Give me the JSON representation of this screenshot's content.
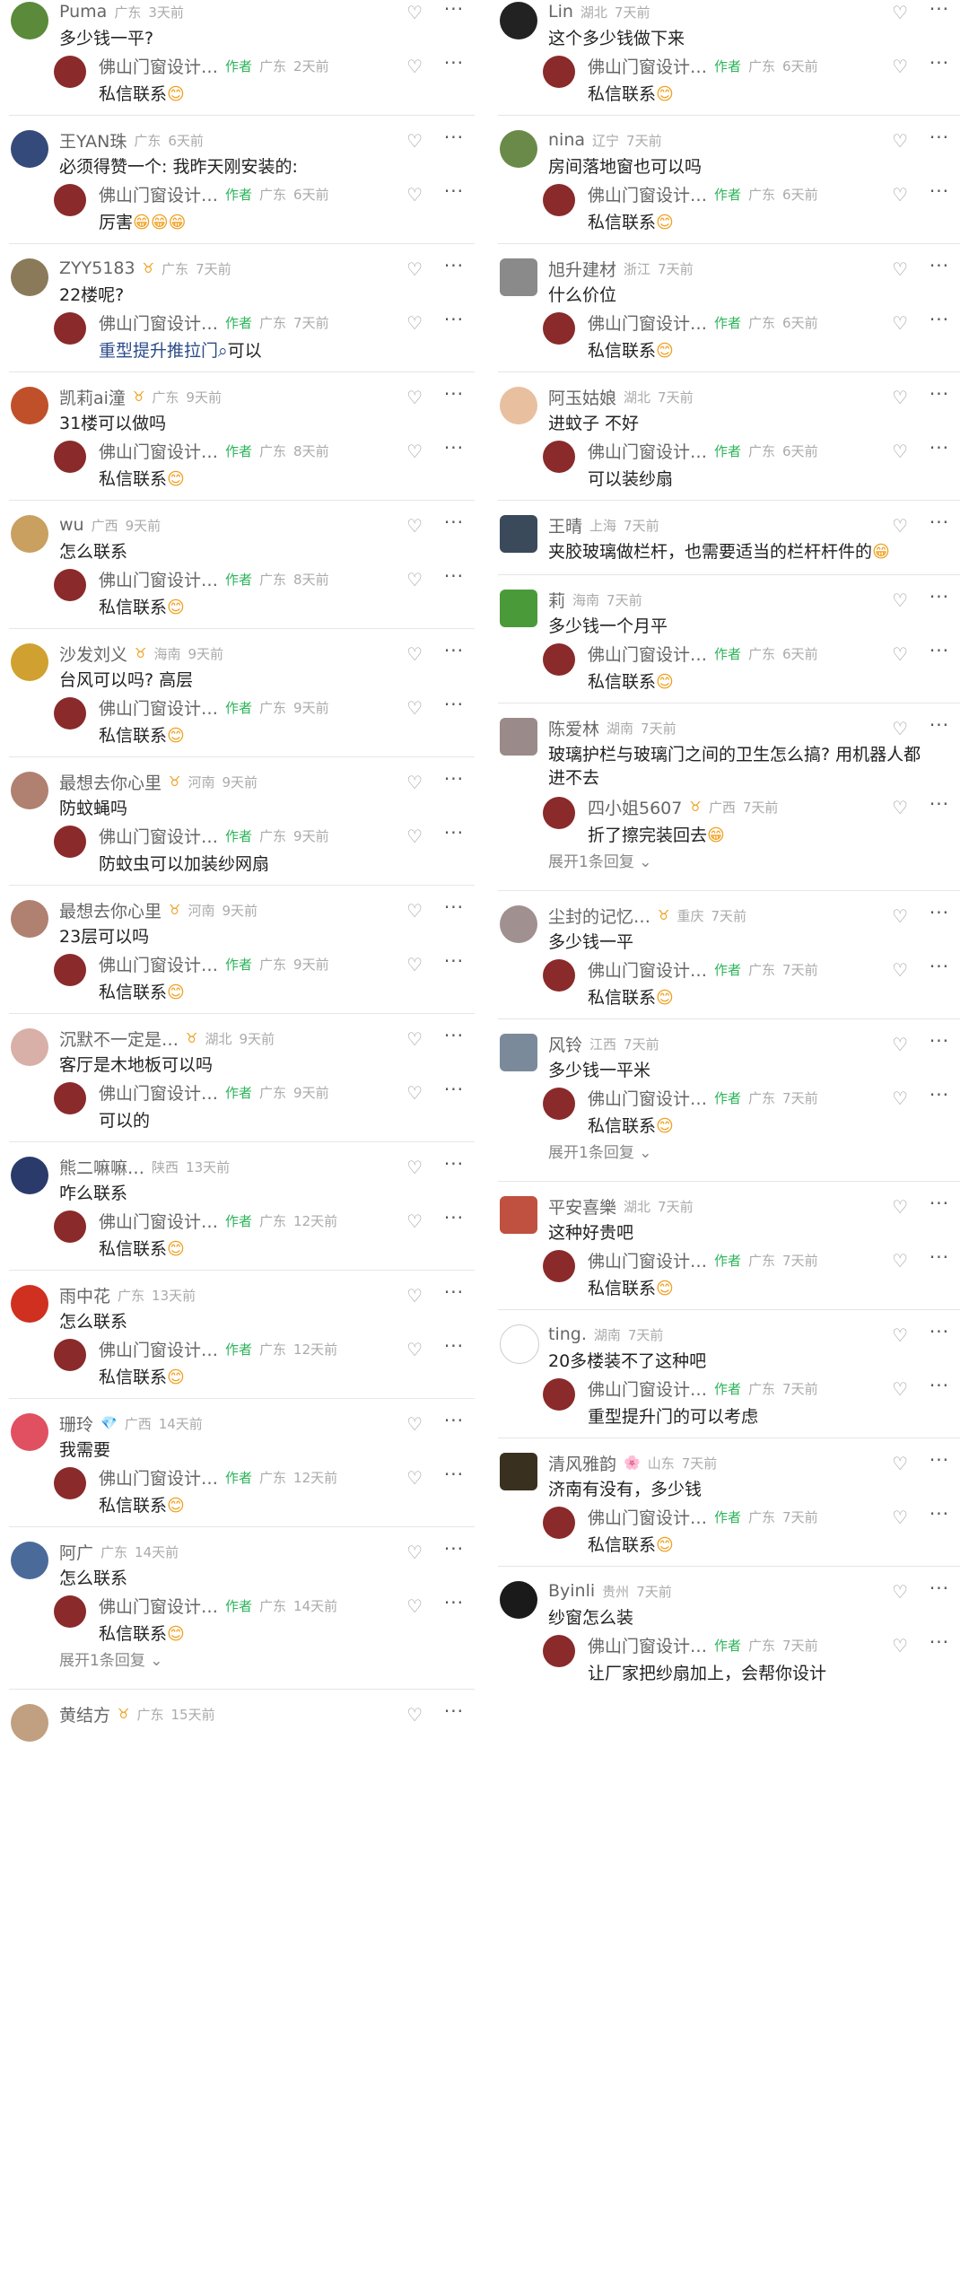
{
  "left": [
    {
      "name": "Puma",
      "loc": "广东",
      "time": "3天前",
      "text": "多少钱一平?",
      "avatar": "#5a8a3a",
      "replies": [
        {
          "name": "佛山门窗设计…",
          "author": "作者",
          "loc": "广东",
          "time": "2天前",
          "text": "私信联系",
          "emoji": "😊"
        }
      ]
    },
    {
      "name": "王YAN珠",
      "loc": "广东",
      "time": "6天前",
      "text": "必须得赞一个: 我昨天刚安装的:",
      "avatar": "#344a7a",
      "replies": [
        {
          "name": "佛山门窗设计…",
          "author": "作者",
          "loc": "广东",
          "time": "6天前",
          "text": "厉害",
          "emoji": "😁😁😁"
        }
      ]
    },
    {
      "name": "ZYY5183",
      "badge": "♉",
      "loc": "广东",
      "time": "7天前",
      "text": "22楼呢?",
      "avatar": "#8a7a5a",
      "replies": [
        {
          "name": "佛山门窗设计…",
          "author": "作者",
          "loc": "广东",
          "time": "7天前",
          "text": "重型提升推拉门",
          "link": true,
          "text2": "可以"
        }
      ]
    },
    {
      "name": "凯莉ai潼",
      "badge": "♉",
      "loc": "广东",
      "time": "9天前",
      "text": "31楼可以做吗",
      "avatar": "#c0502a",
      "replies": [
        {
          "name": "佛山门窗设计…",
          "author": "作者",
          "loc": "广东",
          "time": "8天前",
          "text": "私信联系",
          "emoji": "😊"
        }
      ]
    },
    {
      "name": "wu",
      "loc": "广西",
      "time": "9天前",
      "text": "怎么联系",
      "avatar": "#c9a060",
      "replies": [
        {
          "name": "佛山门窗设计…",
          "author": "作者",
          "loc": "广东",
          "time": "8天前",
          "text": "私信联系",
          "emoji": "😊"
        }
      ]
    },
    {
      "name": "沙发刘义",
      "badge": "♉",
      "loc": "海南",
      "time": "9天前",
      "text": "台风可以吗? 高层",
      "avatar": "#d0a030",
      "replies": [
        {
          "name": "佛山门窗设计…",
          "author": "作者",
          "loc": "广东",
          "time": "9天前",
          "text": "私信联系",
          "emoji": "😊"
        }
      ]
    },
    {
      "name": "最想去你心里",
      "badge": "♉",
      "loc": "河南",
      "time": "9天前",
      "text": "防蚊蝇吗",
      "avatar": "#b08070",
      "replies": [
        {
          "name": "佛山门窗设计…",
          "author": "作者",
          "loc": "广东",
          "time": "9天前",
          "text": "防蚊虫可以加装纱网扇"
        }
      ]
    },
    {
      "name": "最想去你心里",
      "badge": "♉",
      "loc": "河南",
      "time": "9天前",
      "text": "23层可以吗",
      "avatar": "#b08070",
      "replies": [
        {
          "name": "佛山门窗设计…",
          "author": "作者",
          "loc": "广东",
          "time": "9天前",
          "text": "私信联系",
          "emoji": "😊"
        }
      ]
    },
    {
      "name": "沉默不一定是…",
      "badge": "♉",
      "loc": "湖北",
      "time": "9天前",
      "text": "客厅是木地板可以吗",
      "avatar": "#d8b0a8",
      "replies": [
        {
          "name": "佛山门窗设计…",
          "author": "作者",
          "loc": "广东",
          "time": "9天前",
          "text": "可以的"
        }
      ]
    },
    {
      "name": "熊二嘛嘛…",
      "loc": "陕西",
      "time": "13天前",
      "text": "咋么联系",
      "avatar": "#2a3a6a",
      "replies": [
        {
          "name": "佛山门窗设计…",
          "author": "作者",
          "loc": "广东",
          "time": "12天前",
          "text": "私信联系",
          "emoji": "😊"
        }
      ]
    },
    {
      "name": "雨中花",
      "loc": "广东",
      "time": "13天前",
      "text": "怎么联系",
      "avatar": "#d03020",
      "replies": [
        {
          "name": "佛山门窗设计…",
          "author": "作者",
          "loc": "广东",
          "time": "12天前",
          "text": "私信联系",
          "emoji": "😊"
        }
      ]
    },
    {
      "name": "珊玲",
      "badge": "💎",
      "loc": "广西",
      "time": "14天前",
      "text": "我需要",
      "avatar": "#e05060",
      "replies": [
        {
          "name": "佛山门窗设计…",
          "author": "作者",
          "loc": "广东",
          "time": "12天前",
          "text": "私信联系",
          "emoji": "😊"
        }
      ]
    },
    {
      "name": "阿广",
      "loc": "广东",
      "time": "14天前",
      "text": "怎么联系",
      "avatar": "#4a6a9a",
      "replies": [
        {
          "name": "佛山门窗设计…",
          "author": "作者",
          "loc": "广东",
          "time": "14天前",
          "text": "私信联系",
          "emoji": "😊"
        }
      ],
      "expand": "展开1条回复"
    },
    {
      "name": "黄结方",
      "badge": "♉",
      "loc": "广东",
      "time": "15天前",
      "text": "",
      "avatar": "#c0a080",
      "replies": []
    }
  ],
  "right": [
    {
      "name": "Lin",
      "loc": "湖北",
      "time": "7天前",
      "text": "这个多少钱做下来",
      "avatar": "#222222",
      "replies": [
        {
          "name": "佛山门窗设计…",
          "author": "作者",
          "loc": "广东",
          "time": "6天前",
          "text": "私信联系",
          "emoji": "😊"
        }
      ]
    },
    {
      "name": "nina",
      "loc": "辽宁",
      "time": "7天前",
      "text": "房间落地窗也可以吗",
      "avatar": "#6a8a4a",
      "replies": [
        {
          "name": "佛山门窗设计…",
          "author": "作者",
          "loc": "广东",
          "time": "6天前",
          "text": "私信联系",
          "emoji": "😊"
        }
      ]
    },
    {
      "name": "旭升建材",
      "loc": "浙江",
      "time": "7天前",
      "text": "什么价位",
      "avatar": "#8a8a8a",
      "square": true,
      "replies": [
        {
          "name": "佛山门窗设计…",
          "author": "作者",
          "loc": "广东",
          "time": "6天前",
          "text": "私信联系",
          "emoji": "😊"
        }
      ]
    },
    {
      "name": "阿玉姑娘",
      "loc": "湖北",
      "time": "7天前",
      "text": "进蚊子 不好",
      "avatar": "#e8c0a0",
      "replies": [
        {
          "name": "佛山门窗设计…",
          "author": "作者",
          "loc": "广东",
          "time": "6天前",
          "text": "可以装纱扇"
        }
      ]
    },
    {
      "name": "王晴",
      "loc": "上海",
      "time": "7天前",
      "text": "夹胶玻璃做栏杆，也需要适当的栏杆杆件的",
      "emoji": "😁",
      "avatar": "#3a4a5a",
      "square": true,
      "replies": []
    },
    {
      "name": "莉",
      "loc": "海南",
      "time": "7天前",
      "text": "多少钱一个月平",
      "avatar": "#4a9a3a",
      "square": true,
      "replies": [
        {
          "name": "佛山门窗设计…",
          "author": "作者",
          "loc": "广东",
          "time": "6天前",
          "text": "私信联系",
          "emoji": "😊"
        }
      ]
    },
    {
      "name": "陈爱林",
      "loc": "湖南",
      "time": "7天前",
      "text": "玻璃护栏与玻璃门之间的卫生怎么搞? 用机器人都",
      "text2": "进不去",
      "avatar": "#9a8a8a",
      "square": true,
      "replies": [
        {
          "name": "四小姐5607",
          "badge": "♉",
          "loc": "广西",
          "time": "7天前",
          "text": "折了擦完装回去",
          "emoji": "😁"
        }
      ],
      "expand": "展开1条回复"
    },
    {
      "name": "尘封的记忆…",
      "badge": "♉",
      "loc": "重庆",
      "time": "7天前",
      "text": "多少钱一平",
      "avatar": "#a09090",
      "replies": [
        {
          "name": "佛山门窗设计…",
          "author": "作者",
          "loc": "广东",
          "time": "7天前",
          "text": "私信联系",
          "emoji": "😊"
        }
      ]
    },
    {
      "name": "风铃",
      "loc": "江西",
      "time": "7天前",
      "text": "多少钱一平米",
      "avatar": "#7a8a9a",
      "square": true,
      "replies": [
        {
          "name": "佛山门窗设计…",
          "author": "作者",
          "loc": "广东",
          "time": "7天前",
          "text": "私信联系",
          "emoji": "😊"
        }
      ],
      "expand": "展开1条回复"
    },
    {
      "name": "平安喜樂",
      "loc": "湖北",
      "time": "7天前",
      "text": "这种好贵吧",
      "avatar": "#c05040",
      "square": true,
      "replies": [
        {
          "name": "佛山门窗设计…",
          "author": "作者",
          "loc": "广东",
          "time": "7天前",
          "text": "私信联系",
          "emoji": "😊"
        }
      ]
    },
    {
      "name": "ting.",
      "loc": "湖南",
      "time": "7天前",
      "text": "20多楼装不了这种吧",
      "avatar": "#ffffff",
      "replies": [
        {
          "name": "佛山门窗设计…",
          "author": "作者",
          "loc": "广东",
          "time": "7天前",
          "text": "重型提升门的可以考虑"
        }
      ]
    },
    {
      "name": "清风雅韵",
      "badge": "🌸",
      "loc": "山东",
      "time": "7天前",
      "text": "济南有没有，多少钱",
      "avatar": "#3a3020",
      "square": true,
      "replies": [
        {
          "name": "佛山门窗设计…",
          "author": "作者",
          "loc": "广东",
          "time": "7天前",
          "text": "私信联系",
          "emoji": "😊"
        }
      ]
    },
    {
      "name": "Byinli",
      "loc": "贵州",
      "time": "7天前",
      "text": "纱窗怎么装",
      "avatar": "#1a1a1a",
      "replies": [
        {
          "name": "佛山门窗设计…",
          "author": "作者",
          "loc": "广东",
          "time": "7天前",
          "text": "让厂家把纱扇加上，会帮你设计"
        }
      ]
    }
  ],
  "icons": {
    "like": "heart-outline-icon",
    "more": "more-dots-icon",
    "expand": "chevron-down-icon"
  },
  "colors": {
    "author": "#2db35a",
    "meta": "#aaaaaa",
    "name": "#666666"
  }
}
